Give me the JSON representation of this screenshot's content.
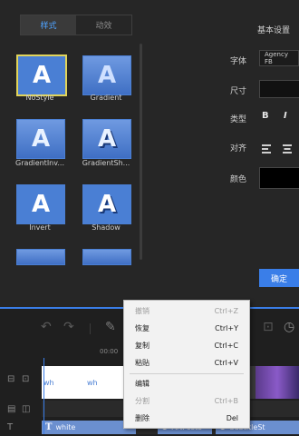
{
  "tabs": {
    "style": "样式",
    "effect": "动效"
  },
  "presets": [
    {
      "label": "NoStyle"
    },
    {
      "label": "Gradient"
    },
    {
      "label": "GradientInv..."
    },
    {
      "label": "GradientSh..."
    },
    {
      "label": "Invert"
    },
    {
      "label": "Shadow"
    }
  ],
  "preset_glyph": "A",
  "settings": {
    "title": "基本设置",
    "font_label": "字体",
    "font_value": "Agency FB",
    "size_label": "尺寸",
    "type_label": "类型",
    "bold": "B",
    "italic": "I",
    "align_label": "对齐",
    "color_label": "颜色",
    "color_value": "#000000",
    "ok": "确定"
  },
  "ruler": {
    "time": "00:00"
  },
  "video_track": {
    "clip1": "wh",
    "clip2": "wh"
  },
  "text_track": {
    "clip1": "white",
    "clip2": "ArtPost3",
    "clip3": "SubtitleSt"
  },
  "context_menu": [
    {
      "label": "撤销",
      "shortcut": "Ctrl+Z",
      "enabled": false
    },
    {
      "label": "恢复",
      "shortcut": "Ctrl+Y",
      "enabled": true
    },
    {
      "label": "复制",
      "shortcut": "Ctrl+C",
      "enabled": true
    },
    {
      "label": "粘贴",
      "shortcut": "Ctrl+V",
      "enabled": true
    },
    {
      "label": "编辑",
      "shortcut": "",
      "enabled": true
    },
    {
      "label": "分割",
      "shortcut": "Ctrl+B",
      "enabled": false
    },
    {
      "label": "删除",
      "shortcut": "Del",
      "enabled": true
    }
  ]
}
